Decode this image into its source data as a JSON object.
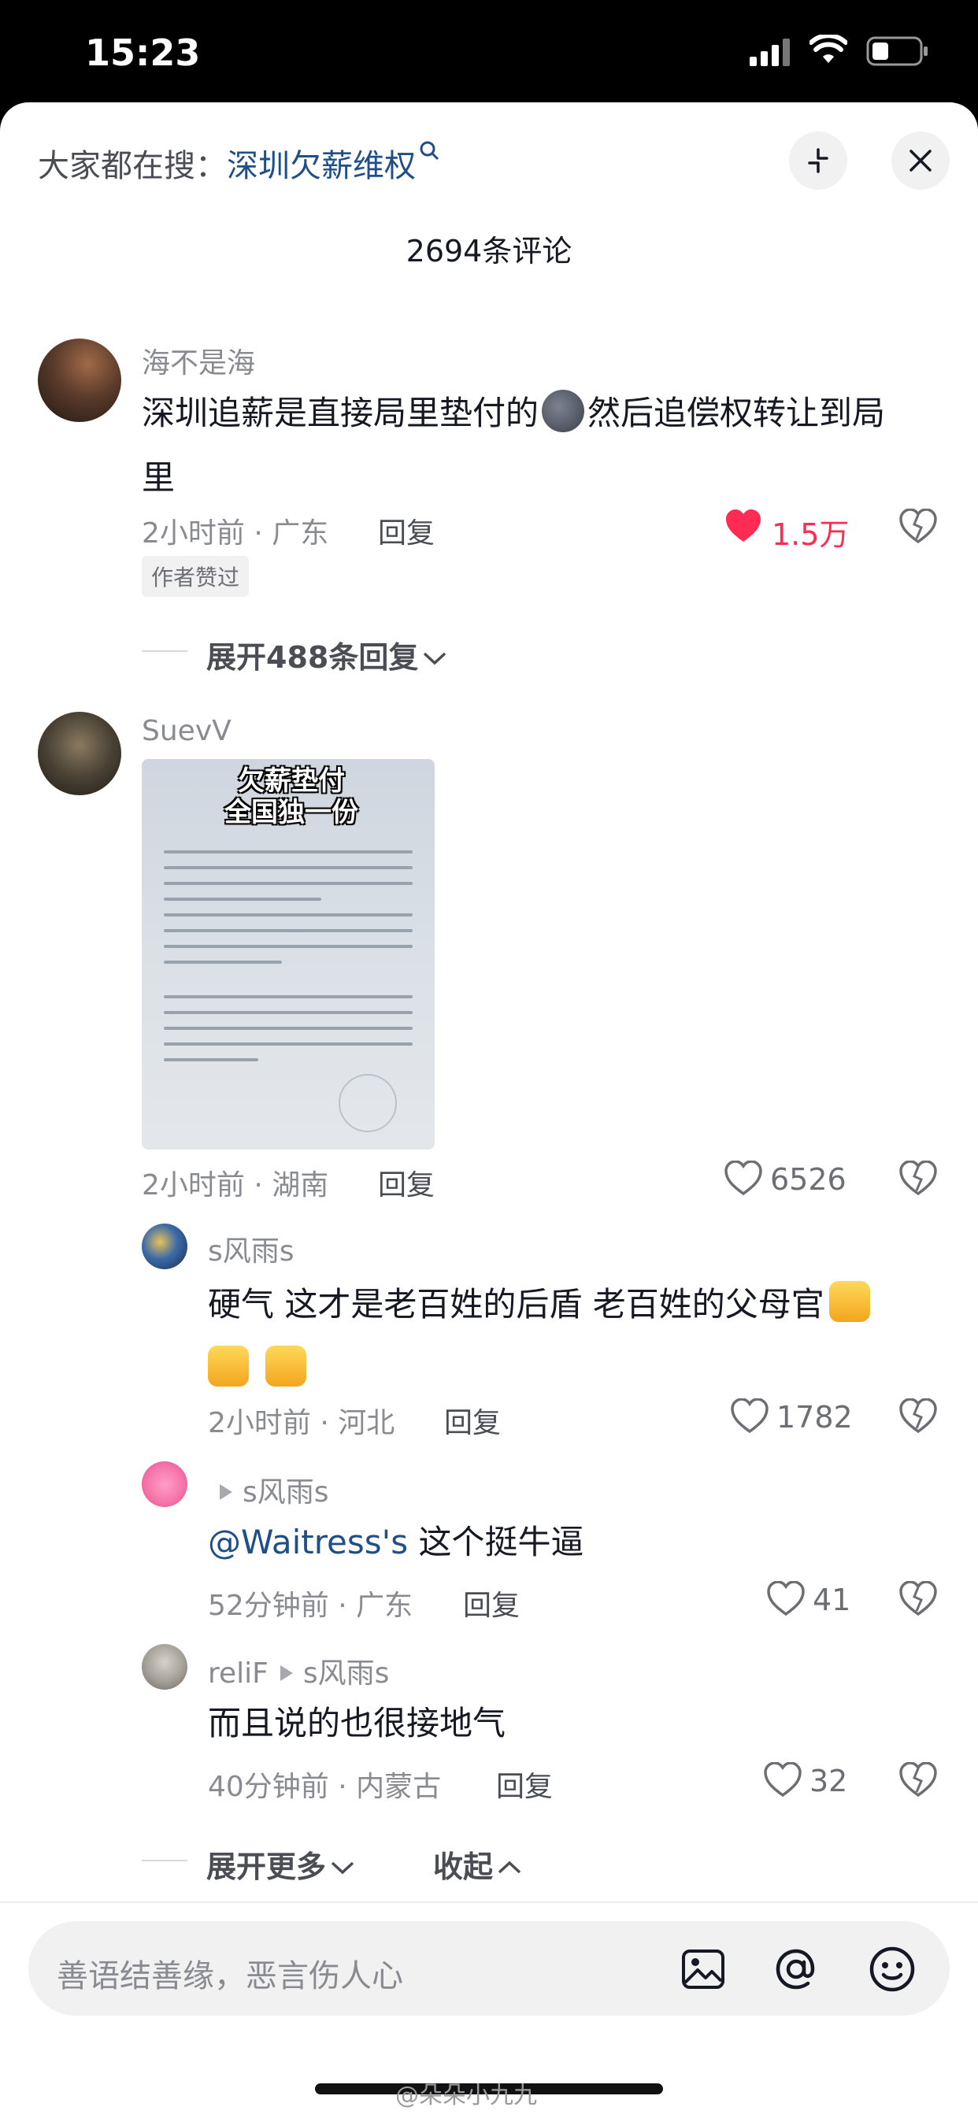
{
  "status_bar": {
    "time": "15:23"
  },
  "header": {
    "search_prefix": "大家都在搜：",
    "search_keyword": "深圳欠薪维权"
  },
  "comment_count": "2694条评论",
  "comments": [
    {
      "username": "海不是海",
      "text_part1": "深圳追薪是直接局里垫付的",
      "text_part2": "然后追偿权转让到局",
      "text_part3": "里",
      "meta": "2小时前 · 广东",
      "reply_label": "回复",
      "likes": "1.5万",
      "tag": "作者赞过",
      "expand_label": "展开488条回复"
    },
    {
      "username": "SuevV",
      "image_caption_line1": "欠薪垫付",
      "image_caption_line2": "全国独一份",
      "meta": "2小时前 · 湖南",
      "reply_label": "回复",
      "likes": "6526"
    }
  ],
  "replies": [
    {
      "username": "s风雨s",
      "text_line1": "硬气 这才是老百姓的后盾 老百姓的父母官",
      "meta": "2小时前 · 河北",
      "reply_label": "回复",
      "likes": "1782"
    },
    {
      "reply_to": "s风雨s",
      "mention": "@Waitress's",
      "text": " 这个挺牛逼",
      "meta": "52分钟前 · 广东",
      "reply_label": "回复",
      "likes": "41"
    },
    {
      "username": "reliF",
      "reply_to": "s风雨s",
      "text": "而且说的也很接地气",
      "meta": "40分钟前 · 内蒙古",
      "reply_label": "回复",
      "likes": "32"
    }
  ],
  "more_label": "展开更多",
  "collapse_label": "收起",
  "input_placeholder": "善语结善缘，恶言伤人心",
  "watermark": "@朵朵小九九",
  "colors": {
    "like_red": "#fe2c55",
    "link_blue": "#1f4f88"
  },
  "icons": [
    "search-icon",
    "collapse-icon",
    "close-icon",
    "heart-icon",
    "dislike-icon",
    "chevron-down-icon",
    "chevron-up-icon",
    "reply-arrow-icon",
    "image-icon",
    "at-icon",
    "emoji-icon"
  ]
}
